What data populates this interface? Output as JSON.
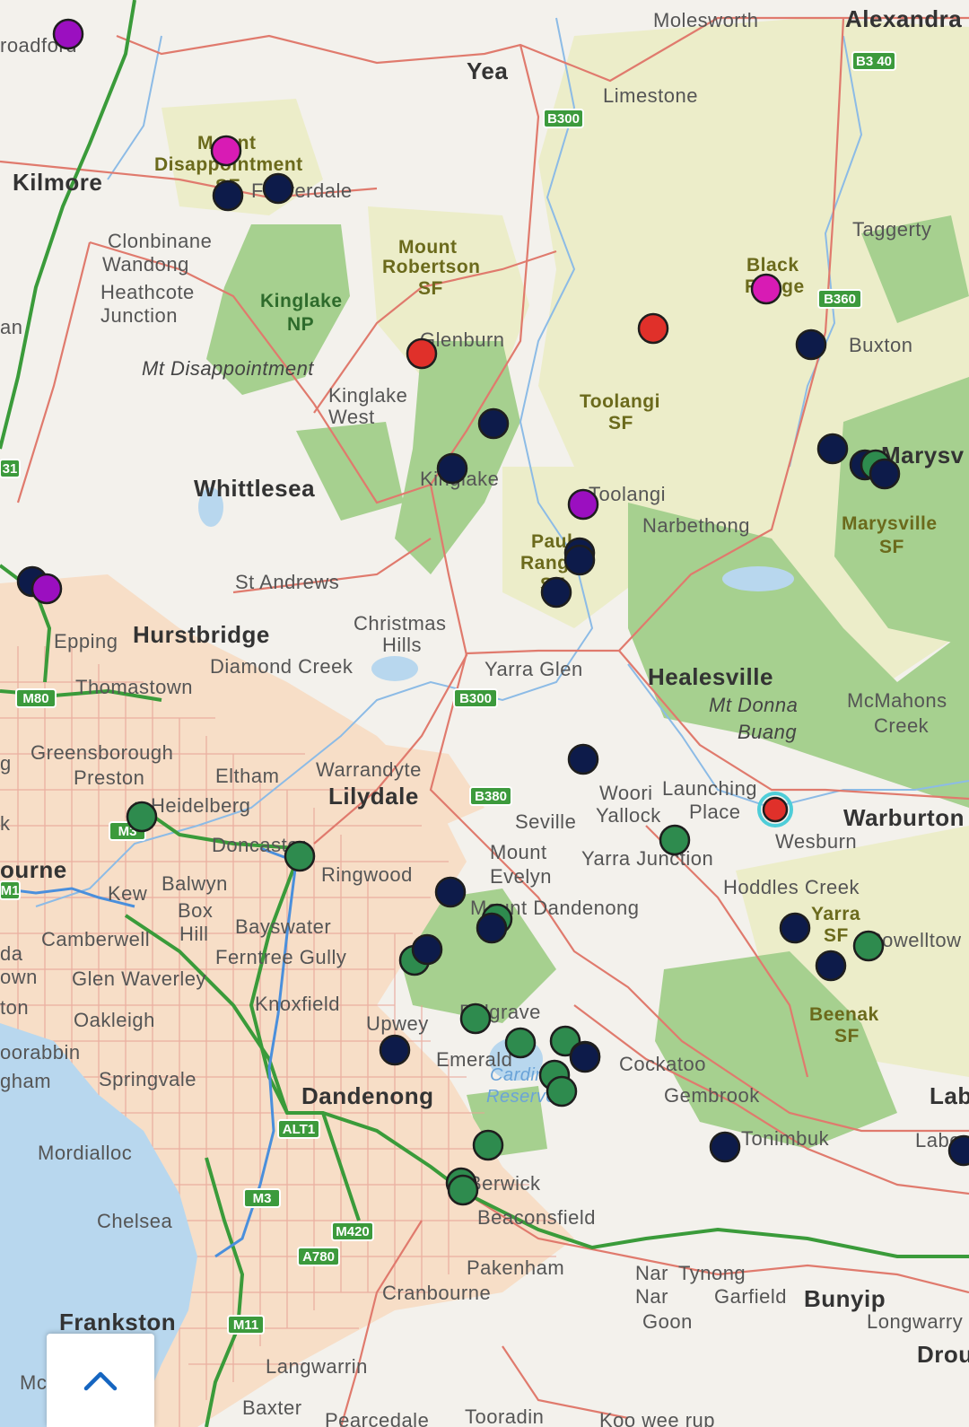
{
  "map": {
    "colors": {
      "land": "#f3f1ec",
      "forest_light": "#ecedc9",
      "park_green": "#9ccb86",
      "urban": "#f6dcc4",
      "water": "#b8d7ee",
      "road_red": "#e07a6d",
      "freeway_green": "#3a9b3a",
      "motorway_blue": "#4a8fdc"
    },
    "labels": [
      {
        "id": "moleswortht",
        "text": "Molesworth",
        "kind": "normal"
      },
      {
        "id": "alexandra",
        "text": "Alexandra",
        "kind": "town"
      },
      {
        "id": "yea",
        "text": "Yea",
        "kind": "town"
      },
      {
        "id": "limestone",
        "text": "Limestone",
        "kind": "normal"
      },
      {
        "id": "broadford",
        "text": "roadford",
        "kind": "normal"
      },
      {
        "id": "mount-disappointment-sf-1",
        "text": "Mount",
        "kind": "forest"
      },
      {
        "id": "mount-disappointment-sf-2",
        "text": "Disappointment",
        "kind": "forest"
      },
      {
        "id": "mount-disappointment-sf-3",
        "text": "SF",
        "kind": "forest"
      },
      {
        "id": "kilmore",
        "text": "Kilmore",
        "kind": "town"
      },
      {
        "id": "flowerdale",
        "text": "Flowerdale",
        "kind": "normal"
      },
      {
        "id": "clonbinane",
        "text": "Clonbinane",
        "kind": "normal"
      },
      {
        "id": "wandong",
        "text": "Wandong",
        "kind": "normal"
      },
      {
        "id": "heathcote-junction-1",
        "text": "Heathcote",
        "kind": "normal"
      },
      {
        "id": "heathcote-junction-2",
        "text": "Junction",
        "kind": "normal"
      },
      {
        "id": "kinglake-np-1",
        "text": "Kinglake",
        "kind": "park"
      },
      {
        "id": "kinglake-np-2",
        "text": "NP",
        "kind": "park"
      },
      {
        "id": "mount-robertson-1",
        "text": "Mount",
        "kind": "forest"
      },
      {
        "id": "mount-robertson-2",
        "text": "Robertson",
        "kind": "forest"
      },
      {
        "id": "mount-robertson-3",
        "text": "SF",
        "kind": "forest"
      },
      {
        "id": "taggerty",
        "text": "Taggerty",
        "kind": "normal"
      },
      {
        "id": "black-range-1",
        "text": "Black",
        "kind": "forest"
      },
      {
        "id": "black-range-2",
        "text": "Range",
        "kind": "forest"
      },
      {
        "id": "buxton",
        "text": "Buxton",
        "kind": "normal"
      },
      {
        "id": "an",
        "text": "an",
        "kind": "normal"
      },
      {
        "id": "glenburn",
        "text": "Glenburn",
        "kind": "normal"
      },
      {
        "id": "mt-disappointment",
        "text": "Mt Disappointment",
        "kind": "ital"
      },
      {
        "id": "kinglake-west-1",
        "text": "Kinglake",
        "kind": "normal"
      },
      {
        "id": "kinglake-west-2",
        "text": "West",
        "kind": "normal"
      },
      {
        "id": "toolangi-sf-1",
        "text": "Toolangi",
        "kind": "forest"
      },
      {
        "id": "toolangi-sf-2",
        "text": "SF",
        "kind": "forest"
      },
      {
        "id": "marysville",
        "text": "Marysv",
        "kind": "town"
      },
      {
        "id": "whittlesea",
        "text": "Whittlesea",
        "kind": "town"
      },
      {
        "id": "kinglake",
        "text": "Kinglake",
        "kind": "normal"
      },
      {
        "id": "toolangi",
        "text": "Toolangi",
        "kind": "normal"
      },
      {
        "id": "narbethong",
        "text": "Narbethong",
        "kind": "normal"
      },
      {
        "id": "marysville-sf-1",
        "text": "Marysville",
        "kind": "forest"
      },
      {
        "id": "marysville-sf-2",
        "text": "SF",
        "kind": "forest"
      },
      {
        "id": "paul-range-1",
        "text": "Paul",
        "kind": "forest"
      },
      {
        "id": "paul-range-2",
        "text": "Range",
        "kind": "forest"
      },
      {
        "id": "paul-range-3",
        "text": "SF",
        "kind": "forest"
      },
      {
        "id": "st-andrews",
        "text": "St Andrews",
        "kind": "normal"
      },
      {
        "id": "christmas-hills-1",
        "text": "Christmas",
        "kind": "normal"
      },
      {
        "id": "christmas-hills-2",
        "text": "Hills",
        "kind": "normal"
      },
      {
        "id": "epping",
        "text": "Epping",
        "kind": "normal"
      },
      {
        "id": "hurstbridge",
        "text": "Hurstbridge",
        "kind": "town"
      },
      {
        "id": "diamond-creek",
        "text": "Diamond Creek",
        "kind": "normal"
      },
      {
        "id": "yarra-glen",
        "text": "Yarra Glen",
        "kind": "normal"
      },
      {
        "id": "healesville",
        "text": "Healesville",
        "kind": "town"
      },
      {
        "id": "mt-donna-buang-1",
        "text": "Mt Donna",
        "kind": "ital"
      },
      {
        "id": "mt-donna-buang-2",
        "text": "Buang",
        "kind": "ital"
      },
      {
        "id": "mcmahons-creek-1",
        "text": "McMahons",
        "kind": "normal"
      },
      {
        "id": "mcmahons-creek-2",
        "text": "Creek",
        "kind": "normal"
      },
      {
        "id": "thomastown",
        "text": "Thomastown",
        "kind": "normal"
      },
      {
        "id": "greensborough",
        "text": "Greensborough",
        "kind": "normal"
      },
      {
        "id": "preston",
        "text": "Preston",
        "kind": "normal"
      },
      {
        "id": "eltham",
        "text": "Eltham",
        "kind": "normal"
      },
      {
        "id": "warrandyte",
        "text": "Warrandyte",
        "kind": "normal"
      },
      {
        "id": "lilydale",
        "text": "Lilydale",
        "kind": "town"
      },
      {
        "id": "heidelberg",
        "text": "Heidelberg",
        "kind": "normal"
      },
      {
        "id": "seville",
        "text": "Seville",
        "kind": "normal"
      },
      {
        "id": "woori-yallock-1",
        "text": "Woori",
        "kind": "normal"
      },
      {
        "id": "woori-yallock-2",
        "text": "Yallock",
        "kind": "normal"
      },
      {
        "id": "launching-place-1",
        "text": "Launching",
        "kind": "normal"
      },
      {
        "id": "launching-place-2",
        "text": "Place",
        "kind": "normal"
      },
      {
        "id": "warburton",
        "text": "Warburton",
        "kind": "town"
      },
      {
        "id": "wesburn",
        "text": "Wesburn",
        "kind": "normal"
      },
      {
        "id": "doncaster",
        "text": "Doncaster",
        "kind": "normal"
      },
      {
        "id": "melbourne",
        "text": "ourne",
        "kind": "town"
      },
      {
        "id": "ringwood",
        "text": "Ringwood",
        "kind": "normal"
      },
      {
        "id": "mount-evelyn-1",
        "text": "Mount",
        "kind": "normal"
      },
      {
        "id": "mount-evelyn-2",
        "text": "Evelyn",
        "kind": "normal"
      },
      {
        "id": "yarra-junction",
        "text": "Yarra Junction",
        "kind": "normal"
      },
      {
        "id": "hoddles-creek",
        "text": "Hoddles Creek",
        "kind": "normal"
      },
      {
        "id": "kew",
        "text": "Kew",
        "kind": "normal"
      },
      {
        "id": "balwyn",
        "text": "Balwyn",
        "kind": "normal"
      },
      {
        "id": "box-hill-1",
        "text": "Box",
        "kind": "normal"
      },
      {
        "id": "box-hill-2",
        "text": "Hill",
        "kind": "normal"
      },
      {
        "id": "bayswater",
        "text": "Bayswater",
        "kind": "normal"
      },
      {
        "id": "mount-dandenong",
        "text": "Mount Dandenong",
        "kind": "normal"
      },
      {
        "id": "yarra-sf-1",
        "text": "Yarra",
        "kind": "forest"
      },
      {
        "id": "yarra-sf-2",
        "text": "SF",
        "kind": "forest"
      },
      {
        "id": "powelltown",
        "text": "Powelltow",
        "kind": "normal"
      },
      {
        "id": "camberwell",
        "text": "Camberwell",
        "kind": "normal"
      },
      {
        "id": "ferntree-gully",
        "text": "Ferntree Gully",
        "kind": "normal"
      },
      {
        "id": "glen-waverley",
        "text": "Glen Waverley",
        "kind": "normal"
      },
      {
        "id": "knoxfield",
        "text": "Knoxfield",
        "kind": "normal"
      },
      {
        "id": "oakleigh",
        "text": "Oakleigh",
        "kind": "normal"
      },
      {
        "id": "upwey",
        "text": "Upwey",
        "kind": "normal"
      },
      {
        "id": "belgrave",
        "text": "Belgrave",
        "kind": "normal"
      },
      {
        "id": "beenak-sf-1",
        "text": "Beenak",
        "kind": "forest"
      },
      {
        "id": "beenak-sf-2",
        "text": "SF",
        "kind": "forest"
      },
      {
        "id": "moorabbin",
        "text": "oorabbin",
        "kind": "normal"
      },
      {
        "id": "emerald",
        "text": "Emerald",
        "kind": "normal"
      },
      {
        "id": "cardinia-1",
        "text": "Cardinia",
        "kind": "water"
      },
      {
        "id": "cardinia-2",
        "text": "Reservoir",
        "kind": "water"
      },
      {
        "id": "cockatoo",
        "text": "Cockatoo",
        "kind": "normal"
      },
      {
        "id": "springvale",
        "text": "Springvale",
        "kind": "normal"
      },
      {
        "id": "gembrook",
        "text": "Gembrook",
        "kind": "normal"
      },
      {
        "id": "dandenong",
        "text": "Dandenong",
        "kind": "town"
      },
      {
        "id": "tonimbuk",
        "text": "Tonimbuk",
        "kind": "normal"
      },
      {
        "id": "labertouche",
        "text": "Labertouche",
        "kind": "normal"
      },
      {
        "id": "mordialloc",
        "text": "Mordialloc",
        "kind": "normal"
      },
      {
        "id": "berwick",
        "text": "Berwick",
        "kind": "normal"
      },
      {
        "id": "chelsea",
        "text": "Chelsea",
        "kind": "normal"
      },
      {
        "id": "beaconsfield",
        "text": "Beaconsfield",
        "kind": "normal"
      },
      {
        "id": "pakenham",
        "text": "Pakenham",
        "kind": "normal"
      },
      {
        "id": "nar-nar-goon-1",
        "text": "Nar",
        "kind": "normal"
      },
      {
        "id": "nar-nar-goon-2",
        "text": "Nar",
        "kind": "normal"
      },
      {
        "id": "nar-nar-goon-3",
        "text": "Goon",
        "kind": "normal"
      },
      {
        "id": "tynong",
        "text": "Tynong",
        "kind": "normal"
      },
      {
        "id": "garfield",
        "text": "Garfield",
        "kind": "normal"
      },
      {
        "id": "bunyip",
        "text": "Bunyip",
        "kind": "town"
      },
      {
        "id": "longwarry",
        "text": "Longwarry",
        "kind": "normal"
      },
      {
        "id": "cranbourne",
        "text": "Cranbourne",
        "kind": "normal"
      },
      {
        "id": "frankston",
        "text": "Frankston",
        "kind": "town"
      },
      {
        "id": "drouin",
        "text": "Drou",
        "kind": "town"
      },
      {
        "id": "langwarrin",
        "text": "Langwarrin",
        "kind": "normal"
      },
      {
        "id": "baxter",
        "text": "Baxter",
        "kind": "normal"
      },
      {
        "id": "pearcedale",
        "text": "Pearcedale",
        "kind": "normal"
      },
      {
        "id": "tooradin",
        "text": "Tooradin",
        "kind": "normal"
      },
      {
        "id": "koo-wee-rup",
        "text": "Koo wee rup",
        "kind": "normal"
      },
      {
        "id": "edge-g",
        "text": "g",
        "kind": "normal"
      },
      {
        "id": "edge-k",
        "text": "k",
        "kind": "normal"
      },
      {
        "id": "edge-da",
        "text": "da",
        "kind": "normal"
      },
      {
        "id": "edge-own",
        "text": "own",
        "kind": "normal"
      },
      {
        "id": "edge-ton",
        "text": "ton",
        "kind": "normal"
      },
      {
        "id": "edge-gham",
        "text": "gham",
        "kind": "normal"
      },
      {
        "id": "edge-mc",
        "text": "Mc",
        "kind": "normal"
      },
      {
        "id": "edge-labe",
        "text": "Labe",
        "kind": "town"
      }
    ],
    "shields": [
      {
        "id": "b340",
        "text": "B3 40"
      },
      {
        "id": "b300-north",
        "text": "B300"
      },
      {
        "id": "b360",
        "text": "B360"
      },
      {
        "id": "m31",
        "text": "31"
      },
      {
        "id": "m80",
        "text": "M80"
      },
      {
        "id": "b300-south",
        "text": "B300"
      },
      {
        "id": "b380",
        "text": "B380"
      },
      {
        "id": "m3-north",
        "text": "M3"
      },
      {
        "id": "m1",
        "text": "M1"
      },
      {
        "id": "alt1",
        "text": "ALT1"
      },
      {
        "id": "m3-south",
        "text": "M3"
      },
      {
        "id": "m420",
        "text": "M420"
      },
      {
        "id": "a780",
        "text": "A780"
      },
      {
        "id": "m11",
        "text": "M11"
      }
    ],
    "marker_types": {
      "navy": "#0d1b4a",
      "green": "#2e8b4e",
      "purple": "#9b0fc0",
      "magenta": "#d81bb4",
      "red": "#e0302a",
      "selected_red": "#e0302a",
      "selected_ring": "#4ecdd8"
    },
    "markers": [
      {
        "type": "purple"
      },
      {
        "type": "magenta"
      },
      {
        "type": "navy"
      },
      {
        "type": "navy"
      },
      {
        "type": "red"
      },
      {
        "type": "red"
      },
      {
        "type": "magenta"
      },
      {
        "type": "navy"
      },
      {
        "type": "navy"
      },
      {
        "type": "navy"
      },
      {
        "type": "navy"
      },
      {
        "type": "navy"
      },
      {
        "type": "green"
      },
      {
        "type": "navy"
      },
      {
        "type": "purple"
      },
      {
        "type": "navy"
      },
      {
        "type": "navy"
      },
      {
        "type": "navy"
      },
      {
        "type": "navy"
      },
      {
        "type": "purple"
      },
      {
        "type": "navy"
      },
      {
        "type": "green"
      },
      {
        "type": "green"
      },
      {
        "type": "green"
      },
      {
        "type": "selected_red"
      },
      {
        "type": "navy"
      },
      {
        "type": "green"
      },
      {
        "type": "navy"
      },
      {
        "type": "navy"
      },
      {
        "type": "green"
      },
      {
        "type": "navy"
      },
      {
        "type": "green"
      },
      {
        "type": "navy"
      },
      {
        "type": "green"
      },
      {
        "type": "navy"
      },
      {
        "type": "green"
      },
      {
        "type": "green"
      },
      {
        "type": "navy"
      },
      {
        "type": "green"
      },
      {
        "type": "green"
      },
      {
        "type": "green"
      },
      {
        "type": "navy"
      },
      {
        "type": "green"
      },
      {
        "type": "green"
      },
      {
        "type": "navy"
      },
      {
        "type": "navy"
      }
    ]
  },
  "ui": {
    "collapse_button_icon": "chevron-up-icon",
    "accent": "#1565c0"
  }
}
